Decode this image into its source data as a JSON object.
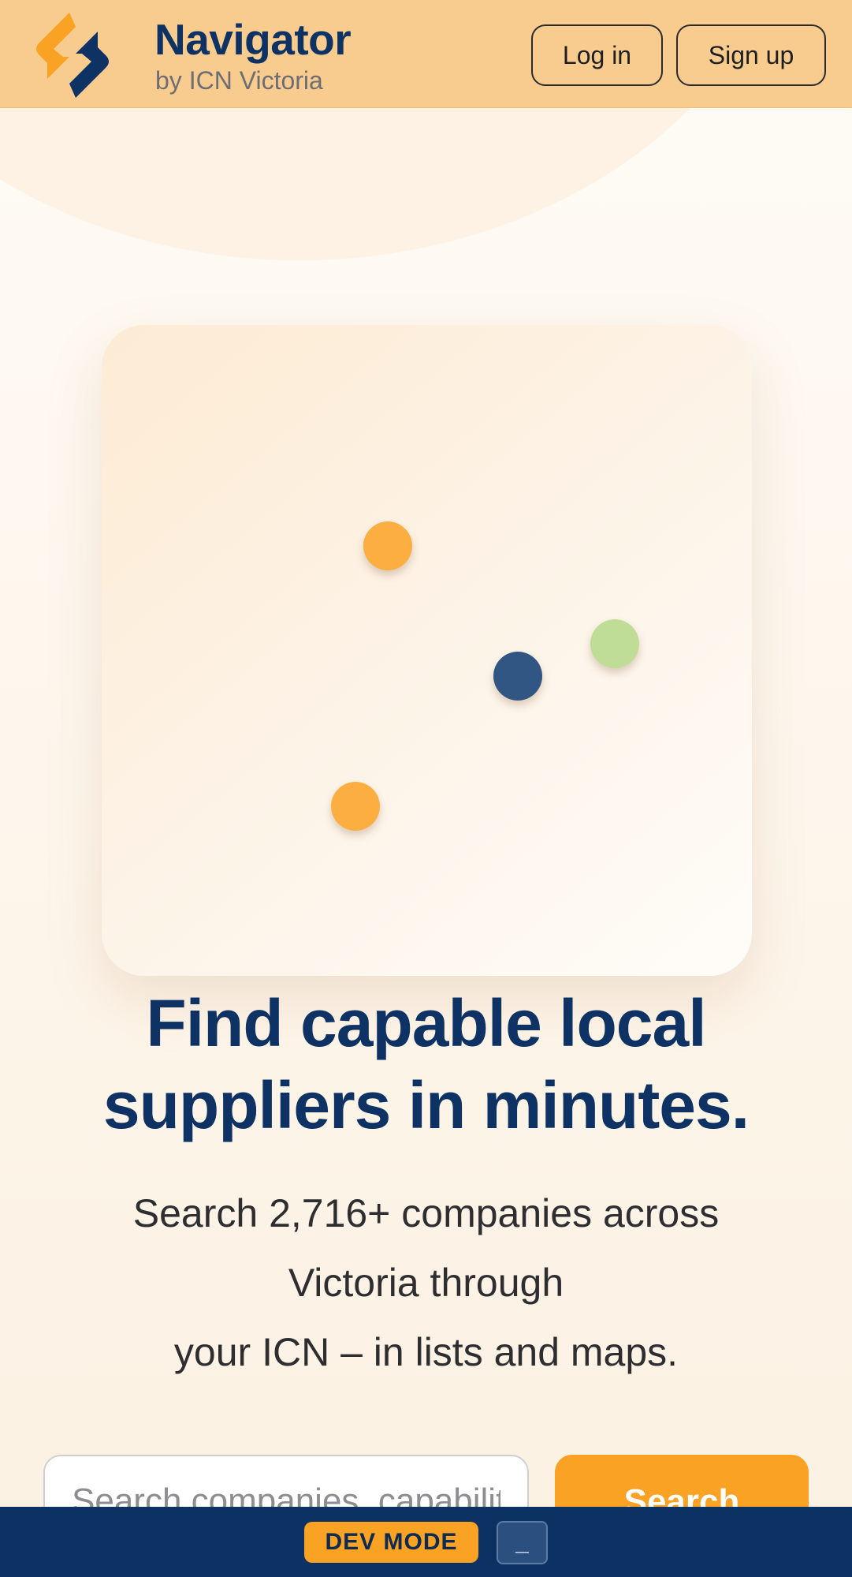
{
  "header": {
    "brand_title": "Navigator",
    "brand_subtitle": "by ICN Victoria",
    "login_label": "Log in",
    "signup_label": "Sign up",
    "logo_icon": "navigator-logo-icon"
  },
  "hero": {
    "headline": "Find capable local suppliers in minutes.",
    "subline_lines": [
      "Search 2,716+ companies across",
      "Victoria through",
      "your ICN – in lists and maps."
    ],
    "dot_icons": [
      "orange-map-dot",
      "navy-map-dot",
      "green-map-dot",
      "orange-map-dot"
    ]
  },
  "search": {
    "placeholder": "Search companies, capabilit",
    "button_label": "Search"
  },
  "devbar": {
    "badge_label": "DEV MODE",
    "toggle_label": "_"
  },
  "colors": {
    "header_bg": "#f8cb8f",
    "brand_navy": "#0d3263",
    "accent_orange": "#f9a223",
    "dot_green": "#c0dd97",
    "dot_navy": "#325684",
    "devbar_bg": "#0c3263"
  }
}
